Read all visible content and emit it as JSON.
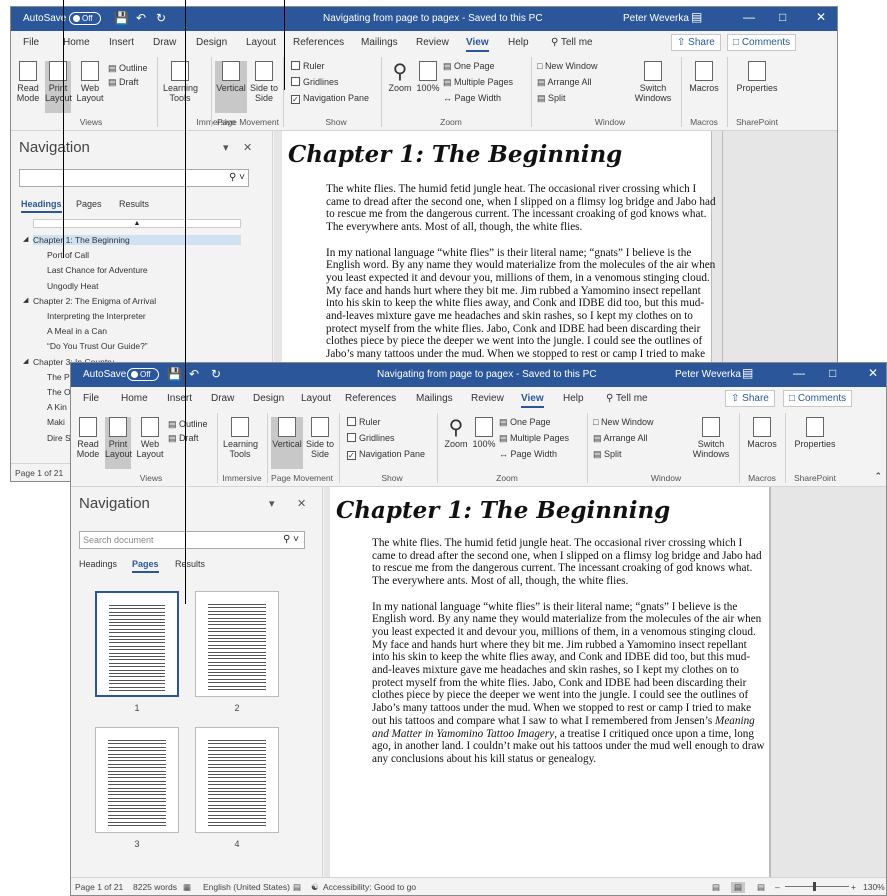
{
  "titlebar": {
    "autosave_label": "AutoSave",
    "autosave_state": "Off",
    "doc_title": "Navigating from page to pagex - Saved to this PC",
    "user": "Peter Weverka"
  },
  "menu": {
    "tabs": [
      "File",
      "Home",
      "Insert",
      "Draw",
      "Design",
      "Layout",
      "References",
      "Mailings",
      "Review",
      "View",
      "Help"
    ],
    "tell_me": "Tell me",
    "share": "Share",
    "comments": "Comments"
  },
  "ribbon": {
    "read_mode": "Read Mode",
    "print_layout": "Print Layout",
    "web_layout": "Web Layout",
    "outline": "Outline",
    "draft": "Draft",
    "learning_tools": "Learning Tools",
    "vertical": "Vertical",
    "side_to_side": "Side to Side",
    "ruler": "Ruler",
    "gridlines": "Gridlines",
    "navigation_pane": "Navigation Pane",
    "zoom": "Zoom",
    "zoom100": "100%",
    "one_page": "One Page",
    "multiple_pages": "Multiple Pages",
    "page_width": "Page Width",
    "new_window": "New Window",
    "arrange_all": "Arrange All",
    "split": "Split",
    "switch_windows": "Switch Windows",
    "macros": "Macros",
    "properties": "Properties",
    "groups": {
      "views": "Views",
      "immersive": "Immersive",
      "page_movement": "Page Movement",
      "show": "Show",
      "zoom": "Zoom",
      "window": "Window",
      "macros": "Macros",
      "sharepoint": "SharePoint"
    }
  },
  "nav": {
    "title": "Navigation",
    "search_placeholder": "Search document",
    "tabs": [
      "Headings",
      "Pages",
      "Results"
    ],
    "headings": [
      {
        "text": "Chapter 1: The Beginning",
        "level": 1
      },
      {
        "text": "Port of Call",
        "level": 2
      },
      {
        "text": "Last Chance for Adventure",
        "level": 2
      },
      {
        "text": "Ungodly Heat",
        "level": 2
      },
      {
        "text": "Chapter 2: The Enigma of Arrival",
        "level": 1
      },
      {
        "text": "Interpreting the Interpreter",
        "level": 2
      },
      {
        "text": "A Meal in a Can",
        "level": 2
      },
      {
        "text": "“Do You Trust Our Guide?”",
        "level": 2
      },
      {
        "text": "Chapter 3: In Country",
        "level": 1
      },
      {
        "text": "The Paragon of Virtue",
        "level": 2
      },
      {
        "text": "The Old Plantation",
        "level": 2
      },
      {
        "text": "A Kin",
        "level": 2
      },
      {
        "text": "Maki",
        "level": 2
      },
      {
        "text": "Dire S",
        "level": 2
      }
    ],
    "page_thumbs": [
      "1",
      "2",
      "3",
      "4"
    ]
  },
  "document": {
    "chapter_title": "Chapter 1: The Beginning",
    "para1": "The white flies. The humid fetid jungle heat. The occasional river crossing which I came to dread after the second one, when I slipped on a flimsy log bridge and Jabo had to rescue me from the dangerous current. The incessant croaking of god knows what. The everywhere ants. Most of all, though, the white flies.",
    "para2a": "In my national language “white flies” is their literal name; “gnats” I believe is the English word. By any name they would materialize from the molecules of the air when you least expected it and devour you, millions of them, in a venomous stinging cloud. My face and hands hurt where they bit me. Jim rubbed a Yamomino insect repellant into his skin to keep the white flies away, and Conk and IDBE did too, but this mud-and-leaves mixture gave me headaches and skin rashes, so I kept my clothes on to protect myself from the white flies. Jabo, Conk and IDBE had been discarding their clothes piece by piece the deeper we went into the jungle. I could see the outlines of Jabo’s many tattoos under the mud. When we stopped to rest or camp I tried to make out his tattoos and compare what I saw to what I remembered from Jensen’s ",
    "book_title": "Meaning and Matter in Yamomino Tattoo Imagery",
    "para2b": ", a treatise I critiqued once upon a time, long ago, in another land. I couldn’t make out his tattoos under the mud well enough to draw any conclusions about his kill status or genealogy."
  },
  "status": {
    "page": "Page 1 of 21",
    "words": "8225 words",
    "language": "English (United States)",
    "accessibility": "Accessibility: Good to go",
    "zoom": "130%"
  }
}
